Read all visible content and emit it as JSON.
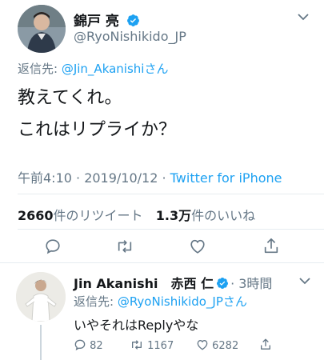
{
  "tweet": {
    "author_name": "錦戸 亮",
    "author_handle": "@RyoNishikido_JP",
    "reply_prefix": "返信先: ",
    "reply_to": "@Jin_Akanishiさん",
    "text_line1": "教えてくれ。",
    "text_line2": "これはリプライか？",
    "timestamp": "午前4:10 · 2019/10/12 · ",
    "source": "Twitter for iPhone",
    "retweets_count": "2660",
    "retweets_label": "件のリツイート",
    "likes_count": "1.3万",
    "likes_label": "件のいいね"
  },
  "reply": {
    "author_name": "Jin Akanishi　赤西 仁",
    "time": "· 3時間",
    "reply_prefix": "返信先: ",
    "reply_to": "@RyoNishikido_JPさん",
    "text": "いやそれはReplyやな",
    "comments": "82",
    "retweets": "1167",
    "likes": "6282"
  },
  "colors": {
    "accent": "#1da1f2",
    "secondary_text": "#657786",
    "divider": "#e6ecf0"
  },
  "icons": [
    "verified-badge-icon",
    "chevron-down-icon",
    "reply-icon",
    "retweet-icon",
    "like-icon",
    "share-icon"
  ]
}
